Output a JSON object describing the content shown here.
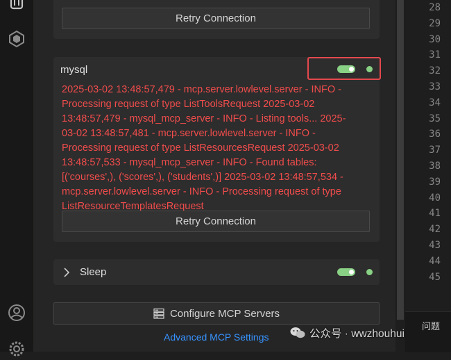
{
  "top_card": {
    "retry_label": "Retry Connection"
  },
  "mysql_card": {
    "name": "mysql",
    "toggle_on": true,
    "status_color": "#89d185",
    "log_lines": [
      "2025-03-02 13:48:57,479 - mcp.server.lowlevel.server - INFO -",
      "Processing request of type ListToolsRequest 2025-03-02",
      "13:48:57,479 - mysql_mcp_server - INFO - Listing tools... 2025-",
      "03-02 13:48:57,481 - mcp.server.lowlevel.server - INFO -",
      "Processing request of type ListResourcesRequest 2025-03-02",
      "13:48:57,533 - mysql_mcp_server - INFO - Found tables:",
      "[('courses',), ('scores',), ('students',)] 2025-03-02 13:48:57,534 -",
      "mcp.server.lowlevel.server - INFO - Processing request of type",
      "ListResourceTemplatesRequest"
    ],
    "retry_label": "Retry Connection"
  },
  "sleep_card": {
    "name": "Sleep",
    "chevron": "chevron-right-icon",
    "toggle_on": true
  },
  "configure_button": {
    "label": "Configure MCP Servers",
    "icon": "server-icon"
  },
  "advanced_link": "Advanced MCP Settings",
  "editor": {
    "line_numbers": [
      "28",
      "29",
      "30",
      "31",
      "32",
      "33",
      "34",
      "35",
      "36",
      "37",
      "38",
      "39",
      "40",
      "41",
      "42",
      "43",
      "44",
      "45"
    ]
  },
  "panel_tab": "问题",
  "watermark": {
    "text": "公众号 · wwzhouhui"
  },
  "colors": {
    "error": "#f14c4c",
    "accent_link": "#3794ff",
    "highlight": "#e5484d",
    "toggle": "#89d185"
  }
}
